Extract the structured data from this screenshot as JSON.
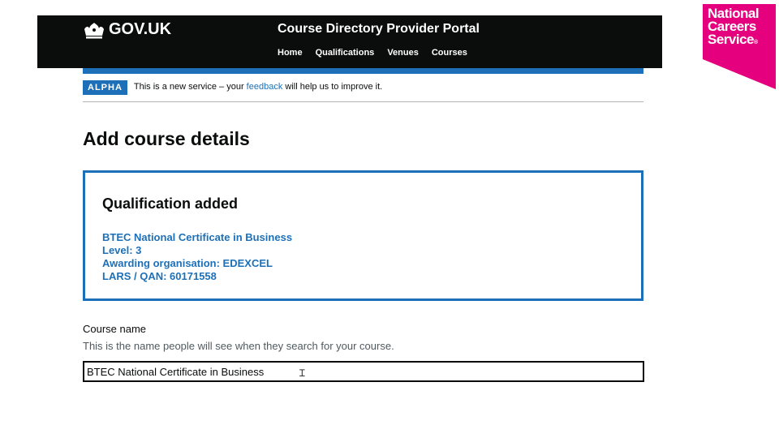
{
  "header": {
    "gov_logo": "GOV.UK",
    "service_name": "Course Directory Provider Portal",
    "nav": [
      "Home",
      "Qualifications",
      "Venues",
      "Courses"
    ]
  },
  "ncs_logo": {
    "lines": [
      "National",
      "Careers",
      "Service"
    ],
    "mark": "®",
    "color": "#e5007e"
  },
  "phase_banner": {
    "tag": "ALPHA",
    "text_before": "This is a new service – your ",
    "link": "feedback",
    "text_after": " will help us to improve it."
  },
  "page_title": "Add course details",
  "qualification": {
    "title": "Qualification added",
    "name": "BTEC National Certificate in Business",
    "level": "Level: 3",
    "awarding": "Awarding organisation: EDEXCEL",
    "lars": "LARS / QAN: 60171558"
  },
  "course_name": {
    "label": "Course name",
    "hint": "This is the name people will see when they search for your course.",
    "value": "BTEC National Certificate in Business"
  },
  "colors": {
    "header_bg": "#0b0c0c",
    "accent_blue": "#1d70b8",
    "ncs_pink": "#e5007e"
  },
  "icons": {
    "crown": "crown-icon",
    "text_cursor": "text-cursor-icon"
  }
}
